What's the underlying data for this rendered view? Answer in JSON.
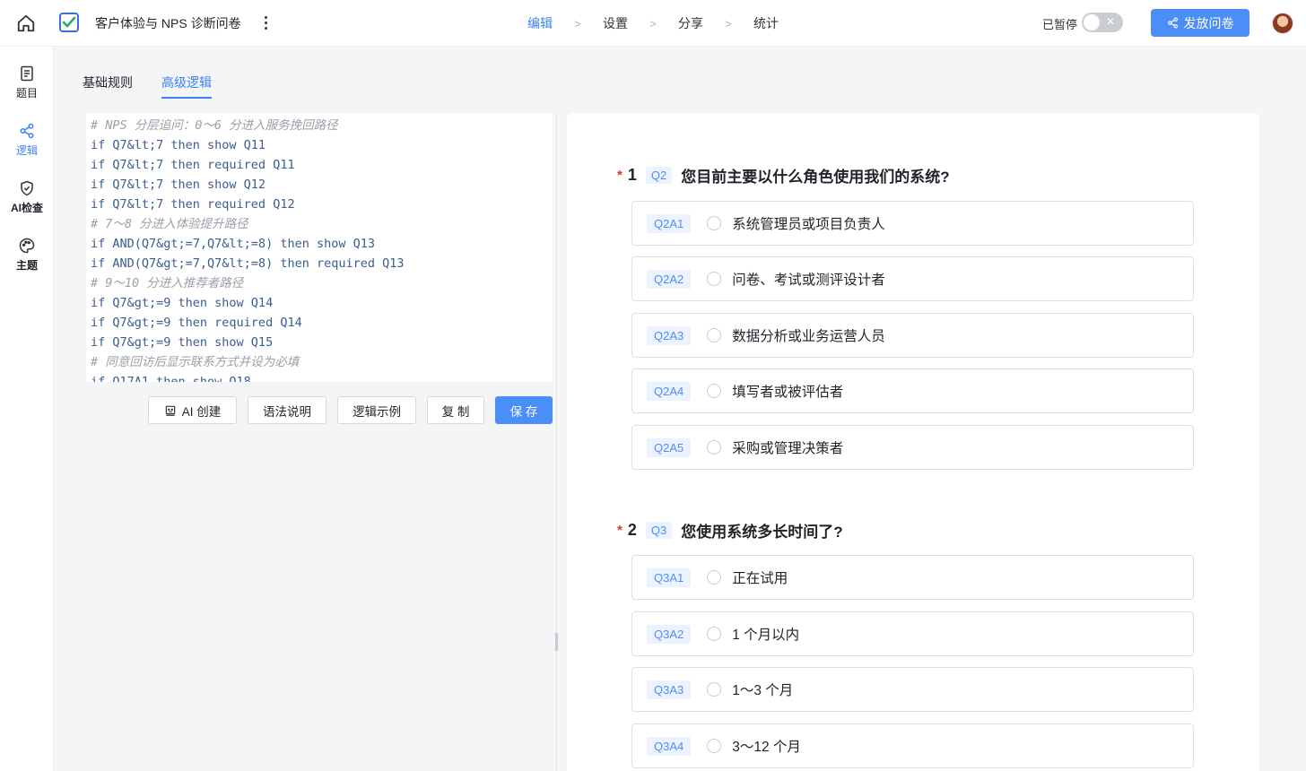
{
  "header": {
    "title": "客户体验与 NPS 诊断问卷",
    "steps": [
      "编辑",
      "设置",
      "分享",
      "统计"
    ],
    "step_separator": ">",
    "status_label": "已暂停",
    "publish_label": "发放问卷"
  },
  "sidebar": {
    "items": [
      {
        "label": "题目",
        "icon": "document-icon"
      },
      {
        "label": "逻辑",
        "icon": "share-nodes-icon"
      },
      {
        "label": "AI检查",
        "icon": "shield-check-icon"
      },
      {
        "label": "主题",
        "icon": "palette-icon"
      }
    ]
  },
  "tabs": [
    "基础规则",
    "高级逻辑"
  ],
  "editor": {
    "lines": [
      "# NPS 分层追问：0～6 分进入服务挽回路径",
      "if Q7&lt;7 then show Q11",
      "if Q7&lt;7 then required Q11",
      "if Q7&lt;7 then show Q12",
      "if Q7&lt;7 then required Q12",
      "# 7～8 分进入体验提升路径",
      "if AND(Q7&gt;=7,Q7&lt;=8) then show Q13",
      "if AND(Q7&gt;=7,Q7&lt;=8) then required Q13",
      "# 9～10 分进入推荐者路径",
      "if Q7&gt;=9 then show Q14",
      "if Q7&gt;=9 then required Q14",
      "if Q7&gt;=9 then show Q15",
      "# 同意回访后显示联系方式并设为必填",
      "if Q17A1 then show Q18"
    ],
    "buttons": {
      "ai_create": "AI 创建",
      "syntax": "语法说明",
      "examples": "逻辑示例",
      "copy": "复 制",
      "save": "保 存"
    }
  },
  "questions": [
    {
      "required_mark": "*",
      "number": "1",
      "id": "Q2",
      "title": "您目前主要以什么角色使用我们的系统?",
      "options": [
        {
          "id": "Q2A1",
          "text": "系统管理员或项目负责人"
        },
        {
          "id": "Q2A2",
          "text": "问卷、考试或测评设计者"
        },
        {
          "id": "Q2A3",
          "text": "数据分析或业务运营人员"
        },
        {
          "id": "Q2A4",
          "text": "填写者或被评估者"
        },
        {
          "id": "Q2A5",
          "text": "采购或管理决策者"
        }
      ]
    },
    {
      "required_mark": "*",
      "number": "2",
      "id": "Q3",
      "title": "您使用系统多长时间了?",
      "options": [
        {
          "id": "Q3A1",
          "text": "正在试用"
        },
        {
          "id": "Q3A2",
          "text": "1 个月以内"
        },
        {
          "id": "Q3A3",
          "text": "1～3 个月"
        },
        {
          "id": "Q3A4",
          "text": "3～12 个月"
        }
      ]
    }
  ]
}
